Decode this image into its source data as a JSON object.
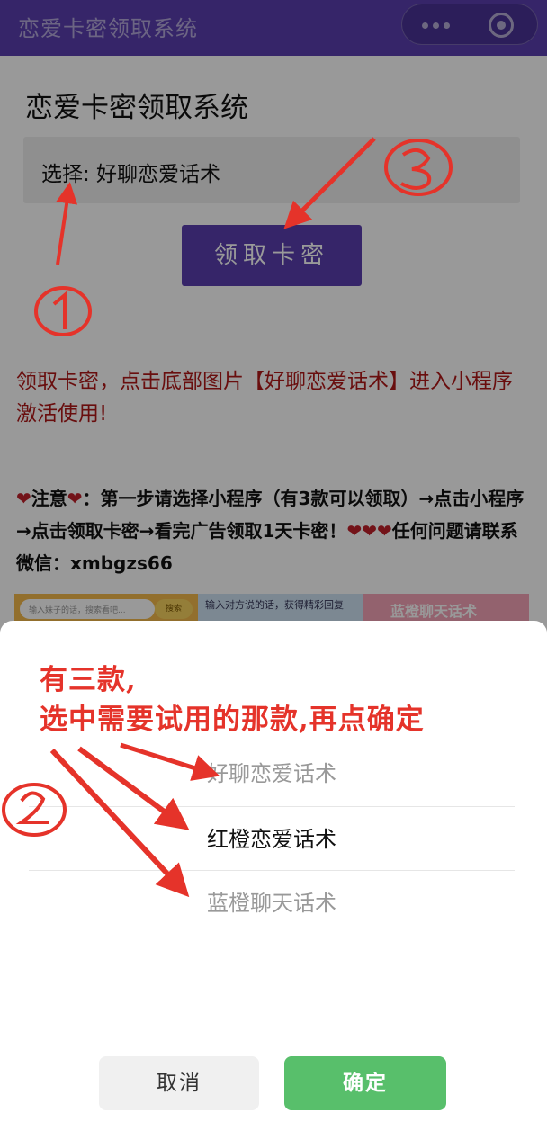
{
  "window": {
    "title": "恋爱卡密领取系统"
  },
  "page": {
    "title": "恋爱卡密领取系统",
    "select_text": "选择: 好聊恋爱话术",
    "claim_button": "领取卡密",
    "red_note": "领取卡密，点击底部图片【好聊恋爱话术】进入小程序激活使用!",
    "notice": {
      "prefix": "注意",
      "body": "：第一步请选择小程序（有3款可以领取）→点击小程序→点击领取卡密→看完广告领取1天卡密！",
      "suffix": "任何问题请联系微信：xmbgzs66",
      "heart": "❤"
    },
    "banner": {
      "search_placeholder": "输入妹子的话，搜索看吧...",
      "search_button": "搜索",
      "middle_text": "输入对方说的话，获得精彩回复",
      "right_text": "蓝橙聊天话术"
    }
  },
  "annotations": {
    "circle_1": "①",
    "circle_2": "②",
    "circle_3": "③",
    "line1": "有三款,",
    "line2": "选中需要试用的那款,再点确定"
  },
  "picker": {
    "options": [
      "好聊恋爱话术",
      "红橙恋爱话术",
      "蓝橙聊天话术"
    ],
    "selected_index": 1
  },
  "buttons": {
    "cancel": "取消",
    "confirm": "确定"
  },
  "colors": {
    "brand": "#5a3fb0",
    "annotation": "#e5332a",
    "confirm": "#58bf6b",
    "note": "#b01818"
  }
}
